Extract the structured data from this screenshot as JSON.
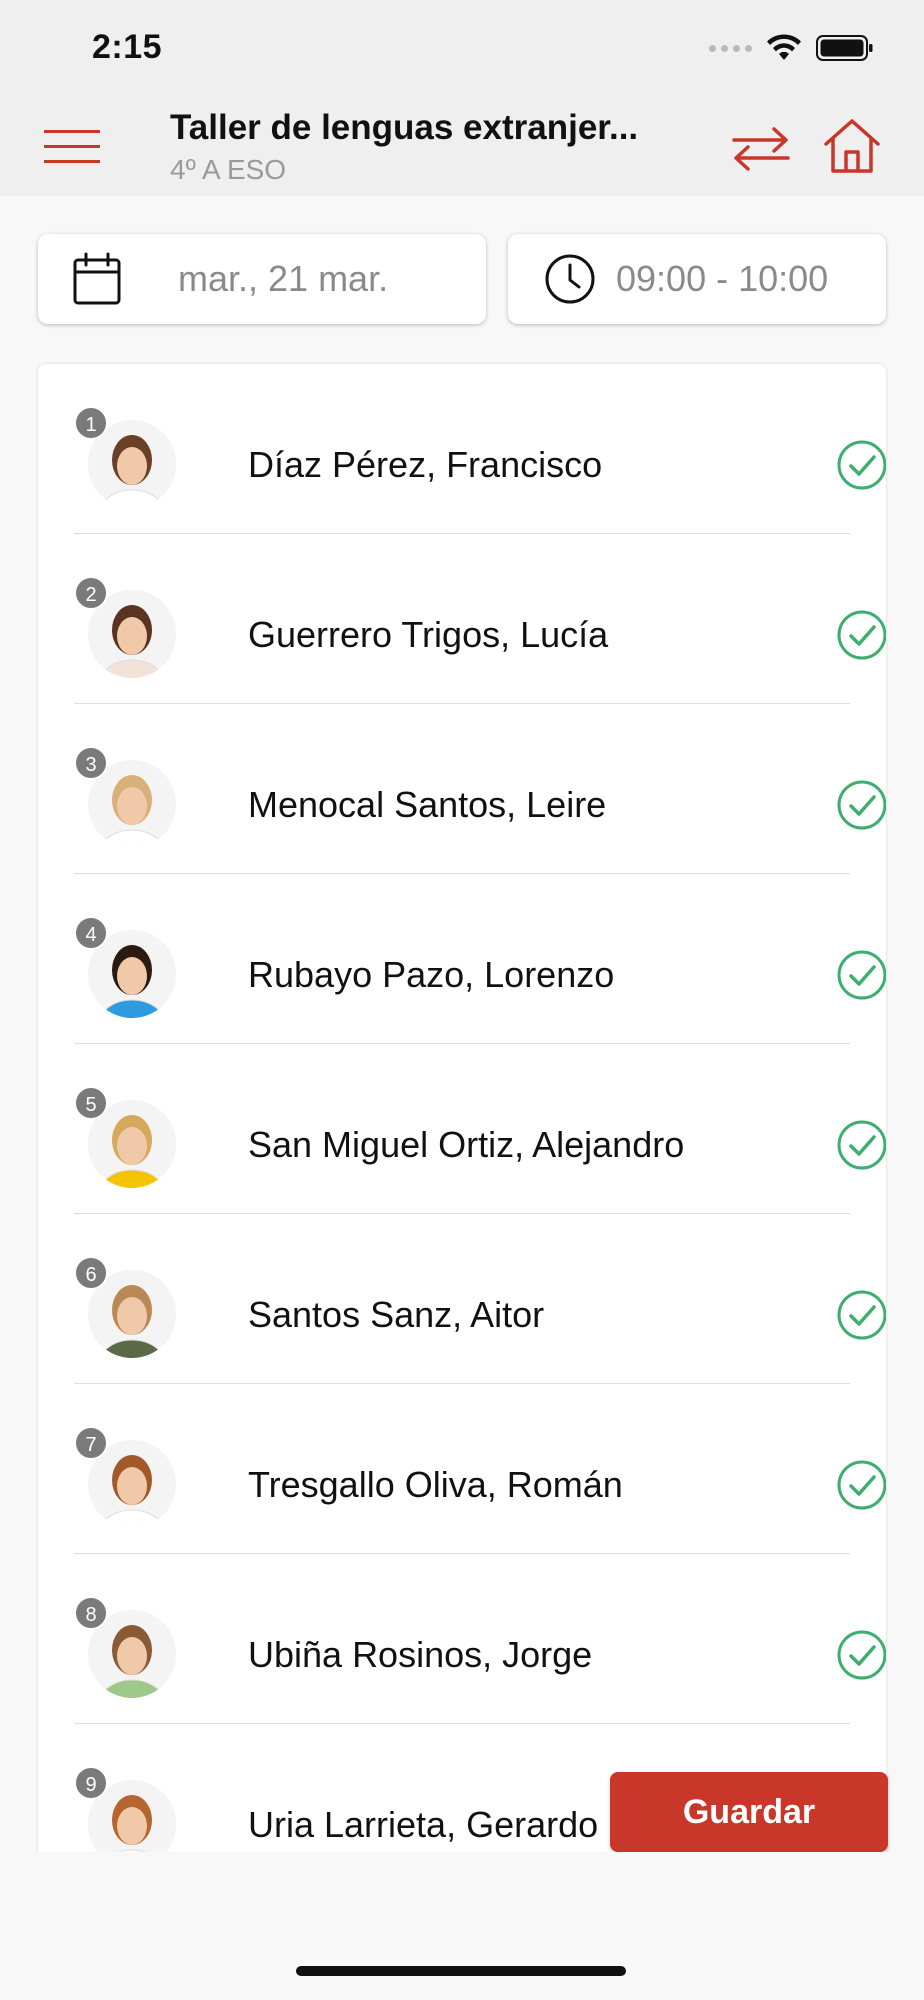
{
  "status_bar": {
    "time": "2:15"
  },
  "nav": {
    "title": "Taller de lenguas extranjer...",
    "subtitle": "4º A ESO",
    "accent_color": "#c8372a",
    "menu_icon": "hamburger-icon",
    "swap_icon": "swap-arrows-icon",
    "home_icon": "home-icon"
  },
  "filters": {
    "date": {
      "icon": "calendar-icon",
      "value": "mar., 21 mar."
    },
    "time": {
      "icon": "clock-icon",
      "value": "09:00 - 10:00"
    }
  },
  "students": [
    {
      "number": "1",
      "name": "Díaz Pérez, Francisco",
      "status_icon": "check-circle-icon",
      "avatar_color": "#6b3f26",
      "shirt_color": "#ffffff"
    },
    {
      "number": "2",
      "name": "Guerrero Trigos, Lucía",
      "status_icon": "check-circle-icon",
      "avatar_color": "#5b3322",
      "shirt_color": "#f3e2d8"
    },
    {
      "number": "3",
      "name": "Menocal Santos, Leire",
      "status_icon": "check-circle-icon",
      "avatar_color": "#d9b07a",
      "shirt_color": "#ffffff"
    },
    {
      "number": "4",
      "name": "Rubayo Pazo, Lorenzo",
      "status_icon": "check-circle-icon",
      "avatar_color": "#2a1a12",
      "shirt_color": "#2d9be0"
    },
    {
      "number": "5",
      "name": "San Miguel Ortiz, Alejandro",
      "status_icon": "check-circle-icon",
      "avatar_color": "#d6a85c",
      "shirt_color": "#f5c400"
    },
    {
      "number": "6",
      "name": "Santos Sanz, Aitor",
      "status_icon": "check-circle-icon",
      "avatar_color": "#b98a55",
      "shirt_color": "#5a6a48"
    },
    {
      "number": "7",
      "name": "Tresgallo Oliva, Román",
      "status_icon": "check-circle-icon",
      "avatar_color": "#a35a2a",
      "shirt_color": "#ffffff"
    },
    {
      "number": "8",
      "name": "Ubiña Rosinos, Jorge",
      "status_icon": "check-circle-icon",
      "avatar_color": "#8a5a35",
      "shirt_color": "#9cc98a"
    },
    {
      "number": "9",
      "name": "Uria Larrieta, Gerardo",
      "status_icon": "check-circle-icon",
      "avatar_color": "#b5652f",
      "shirt_color": "#ffffff"
    }
  ],
  "check_color": "#3dae6e",
  "save_button": {
    "label": "Guardar"
  }
}
